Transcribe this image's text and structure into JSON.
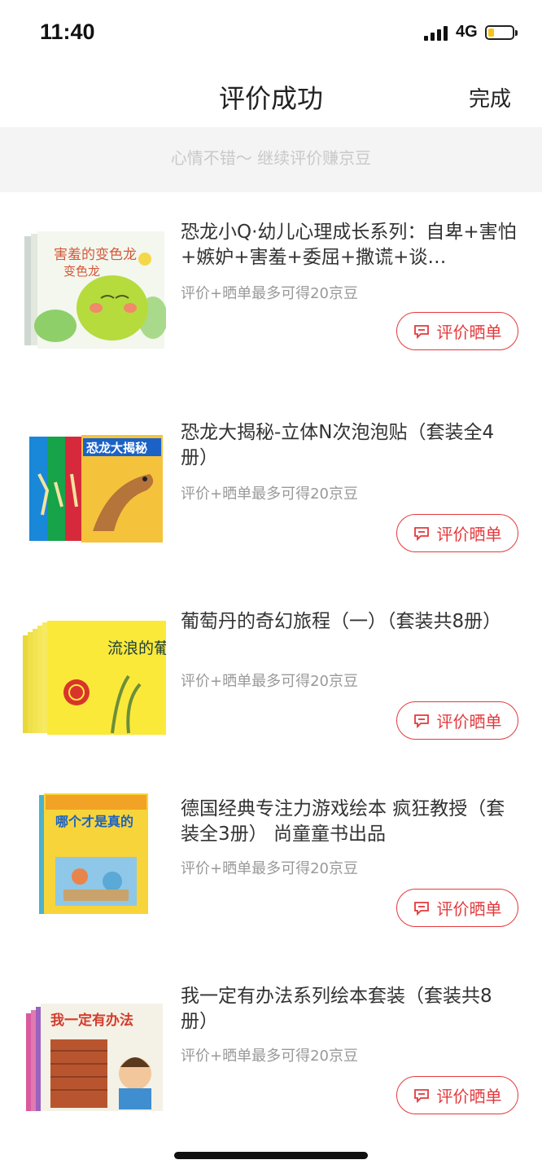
{
  "status_bar": {
    "time": "11:40",
    "network": "4G",
    "battery_percent": 25
  },
  "nav": {
    "title": "评价成功",
    "done_label": "完成"
  },
  "banner": {
    "text": "心情不错～ 继续评价赚京豆"
  },
  "items": [
    {
      "title": "恐龙小Q·幼儿心理成长系列：自卑+害怕+嫉妒+害羞+委屈+撒谎+谈…",
      "hint": "评价+晒单最多可得20京豆",
      "button_label": "评价晒单",
      "cover_text": "害羞的变色龙"
    },
    {
      "title": "恐龙大揭秘-立体N次泡泡贴（套装全4册）",
      "hint": "评价+晒单最多可得20京豆",
      "button_label": "评价晒单",
      "cover_text": "恐龙大揭秘"
    },
    {
      "title": "葡萄丹的奇幻旅程（一）（套装共8册）",
      "hint": "评价+晒单最多可得20京豆",
      "button_label": "评价晒单",
      "cover_text": "流浪的葡萄丹"
    },
    {
      "title": "德国经典专注力游戏绘本 疯狂教授（套装全3册） 尚童童书出品",
      "hint": "评价+晒单最多可得20京豆",
      "button_label": "评价晒单",
      "cover_text": "哪个才是真的"
    },
    {
      "title": "我一定有办法系列绘本套装（套装共8册）",
      "hint": "评价+晒单最多可得20京豆",
      "button_label": "评价晒单",
      "cover_text": "我一定有办法"
    }
  ],
  "colors": {
    "accent": "#e4393c",
    "banner_bg": "#f4f4f4"
  }
}
